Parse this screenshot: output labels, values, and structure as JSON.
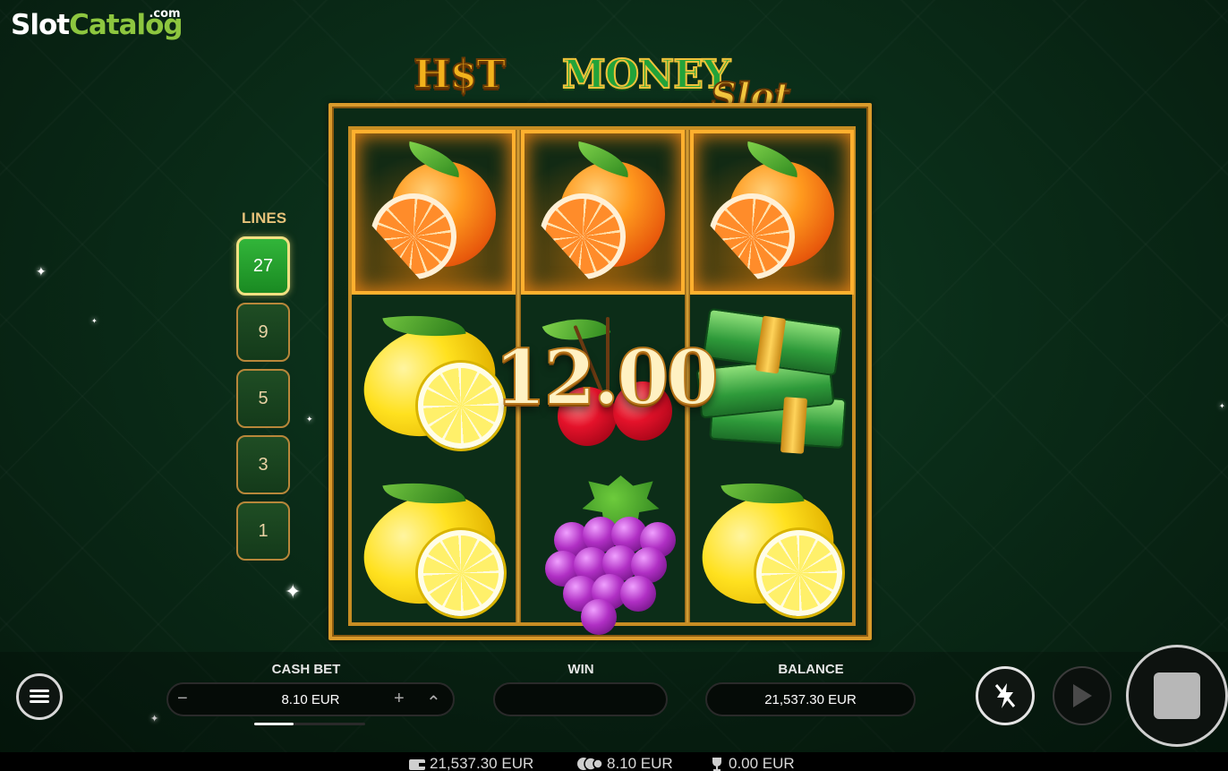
{
  "watermark": {
    "part1": "Slot",
    "part2": "Catalog",
    "part3": ".com"
  },
  "game_logo": {
    "hot": "H$T",
    "money": "MONEY",
    "slot": "Slot"
  },
  "reels": [
    [
      "orange",
      "lemon",
      "lemon"
    ],
    [
      "orange",
      "cherry",
      "grapes"
    ],
    [
      "orange",
      "cash",
      "lemon"
    ]
  ],
  "win_row": 0,
  "win_amount": "12.00",
  "lines": {
    "title": "LINES",
    "options": [
      "27",
      "9",
      "5",
      "3",
      "1"
    ],
    "selected": "27"
  },
  "controls": {
    "cash_bet_label": "CASH BET",
    "cash_bet_value": "8.10 EUR",
    "minus": "−",
    "plus": "+",
    "up": "⌃",
    "win_label": "WIN",
    "win_value": "",
    "balance_label": "BALANCE",
    "balance_value": "21,537.30 EUR",
    "menu_icon": "hamburger-menu-icon",
    "turbo_icon": "lightning-icon",
    "autoplay_icon": "play-icon",
    "spin_icon": "stop-square-icon"
  },
  "status_bar": {
    "balance": "21,537.30 EUR",
    "bet": "8.10 EUR",
    "win": "0.00 EUR"
  },
  "colors": {
    "frame_gold": "#d99a2b",
    "win_glow": "#ffb02e",
    "line_active": "#32b53a",
    "background": "#0a2c18"
  }
}
